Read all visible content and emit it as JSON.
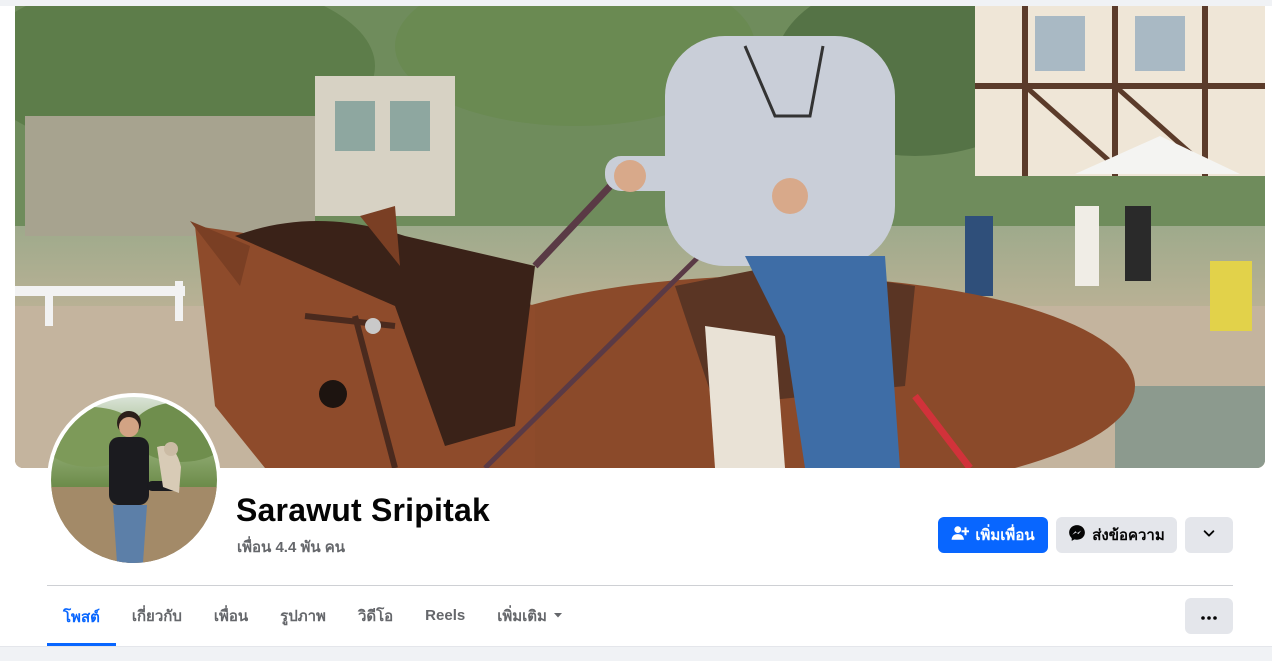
{
  "profile": {
    "name": "Sarawut Sripitak",
    "friends_count": "เพื่อน 4.4 พัน คน"
  },
  "actions": {
    "add_friend_label": "เพิ่มเพื่อน",
    "message_label": "ส่งข้อความ",
    "more_icon": "chevron-down-icon"
  },
  "tabs": [
    {
      "label": "โพสต์",
      "active": true
    },
    {
      "label": "เกี่ยวกับ",
      "active": false
    },
    {
      "label": "เพื่อน",
      "active": false
    },
    {
      "label": "รูปภาพ",
      "active": false
    },
    {
      "label": "วิดีโอ",
      "active": false
    },
    {
      "label": "Reels",
      "active": false
    },
    {
      "label": "เพิ่มเติม",
      "active": false
    }
  ],
  "colors": {
    "accent": "#0866ff",
    "secondary_button": "#e4e6eb",
    "text_primary": "#050505",
    "text_secondary": "#65676b"
  }
}
